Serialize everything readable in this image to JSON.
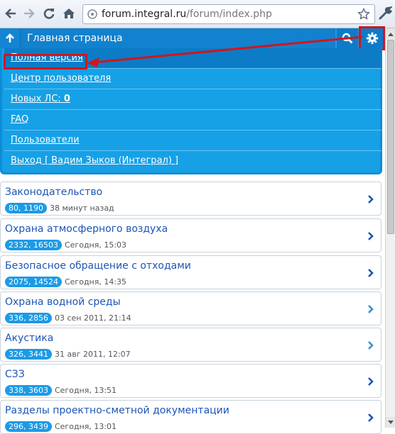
{
  "browser": {
    "url_host": "forum.integral.ru",
    "url_path": "/forum/index.php"
  },
  "header": {
    "title": "Главная страница"
  },
  "menu": {
    "items": [
      {
        "label": "Полная версия"
      },
      {
        "label": "Центр пользователя"
      },
      {
        "label": "Новых ЛС: ",
        "count": "0"
      },
      {
        "label": "FAQ"
      },
      {
        "label": "Пользователи"
      },
      {
        "label": "Выход [ Вадим Зыков (Интеграл) ]"
      }
    ]
  },
  "forums": [
    {
      "title": "Законодательство",
      "counts": "80, 1190",
      "time": "38 минут назад"
    },
    {
      "title": "Охрана атмосферного воздуха",
      "counts": "2332, 16503",
      "time": "Сегодня, 15:03"
    },
    {
      "title": "Безопасное обращение с отходами",
      "counts": "2075, 14524",
      "time": "Сегодня, 14:35"
    },
    {
      "title": "Охрана водной среды",
      "counts": "336, 2856",
      "time": "03 сен 2011, 21:14"
    },
    {
      "title": "Акустика",
      "counts": "326, 3441",
      "time": "31 авг 2011, 12:07"
    },
    {
      "title": "СЗЗ",
      "counts": "338, 3603",
      "time": "Сегодня, 13:51"
    },
    {
      "title": "Разделы проектно-сметной документации",
      "counts": "296, 3439",
      "time": "Сегодня, 13:01"
    }
  ],
  "colors": {
    "header": "#1a9ae8",
    "menu": "#16a0e6",
    "annotation": "#d0161c",
    "link": "#1d55b5"
  }
}
